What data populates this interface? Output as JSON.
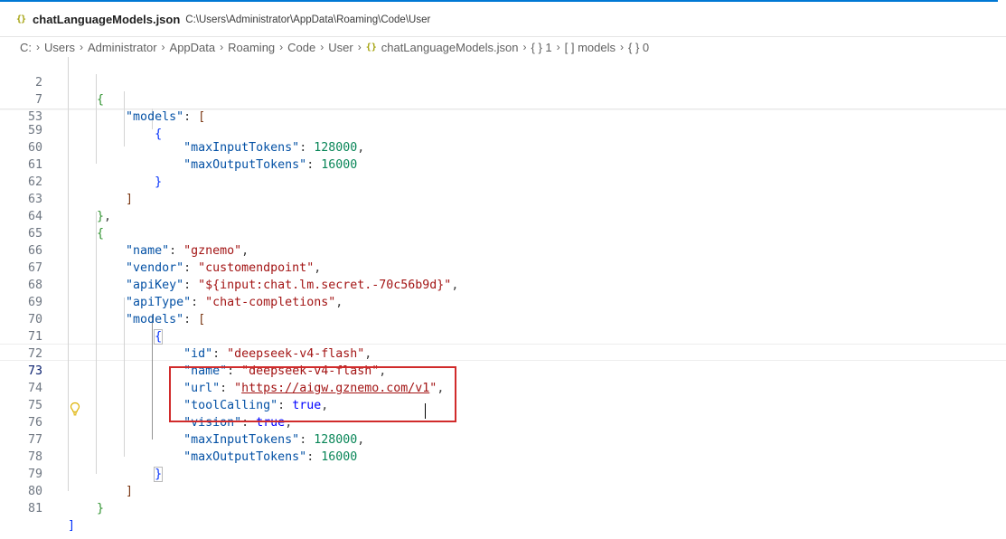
{
  "tab": {
    "icon": "{}",
    "title": "chatLanguageModels.json",
    "path": "C:\\Users\\Administrator\\AppData\\Roaming\\Code\\User"
  },
  "breadcrumb": {
    "items": [
      "C:",
      "Users",
      "Administrator",
      "AppData",
      "Roaming",
      "Code",
      "User"
    ],
    "file_icon": "{}",
    "file": "chatLanguageModels.json",
    "symbols": [
      "{ } 1",
      "[ ] models",
      "{ } 0"
    ]
  },
  "lines": {
    "l2": "2",
    "l7": "7",
    "l53": "53",
    "l59": "59",
    "l60": "60",
    "l61": "61",
    "l62": "62",
    "l63": "63",
    "l64": "64",
    "l65": "65",
    "l66": "66",
    "l67": "67",
    "l68": "68",
    "l69": "69",
    "l70": "70",
    "l71": "71",
    "l72": "72",
    "l73": "73",
    "l74": "74",
    "l75": "75",
    "l76": "76",
    "l77": "77",
    "l78": "78",
    "l79": "79",
    "l80": "80",
    "l81": "81"
  },
  "code": {
    "models_key": "\"models\"",
    "max_input_key": "\"maxInputTokens\"",
    "max_input_val": "128000",
    "max_output_key": "\"maxOutputTokens\"",
    "max_output_val": "16000",
    "name_key": "\"name\"",
    "name_val": "\"gznemo\"",
    "vendor_key": "\"vendor\"",
    "vendor_val": "\"customendpoint\"",
    "apikey_key": "\"apiKey\"",
    "apikey_val": "\"${input:chat.lm.secret.-70c56b9d}\"",
    "apitype_key": "\"apiType\"",
    "apitype_val": "\"chat-completions\"",
    "id_key": "\"id\"",
    "id_val": "\"deepseek-v4-flash\"",
    "model_name_key": "\"name\"",
    "model_name_val": "\"deepseek-v4-flash\"",
    "url_key": "\"url\"",
    "url_quote": "\"",
    "url_val": "https://aigw.gznemo.com/v1",
    "toolcalling_key": "\"toolCalling\"",
    "vision_key": "\"vision\"",
    "true_val": "true",
    "max_input_key2": "\"maxInputTokens\"",
    "max_input_val2": "128000",
    "max_output_key2": "\"maxOutputTokens\"",
    "max_output_val2": "16000"
  },
  "colors": {
    "key": "#0451a5",
    "string": "#a31515",
    "number": "#098658",
    "keyword": "#0000ff",
    "highlight_box": "#d12b2b",
    "json_icon": "#a3a10b"
  },
  "icons": {
    "lightbulb": "lightbulb-icon",
    "chevron": "chevron-right-icon"
  }
}
